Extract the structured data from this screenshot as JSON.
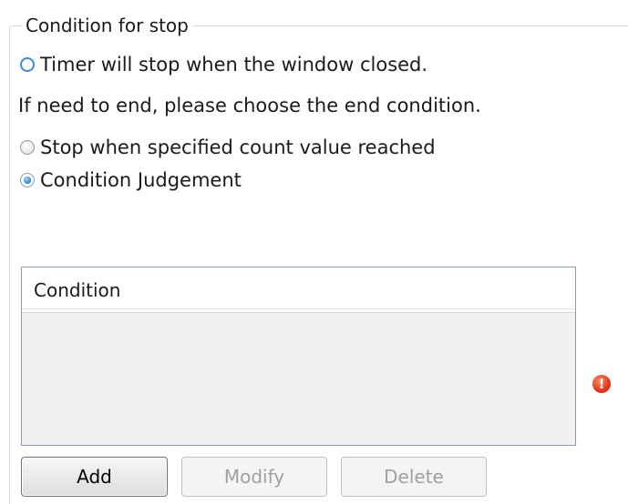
{
  "group": {
    "title": "Condition for stop"
  },
  "options": {
    "timer_close": "Timer will stop when the window closed.",
    "end_hint": "If need to end, please choose the end condition.",
    "count_reached": "Stop when specified count value reached",
    "condition_judgement": "Condition Judgement",
    "selected": "Condition Judgement"
  },
  "list": {
    "columns": [
      "Condition"
    ],
    "rows": []
  },
  "buttons": {
    "add": "Add",
    "modify": "Modify",
    "delete": "Delete"
  },
  "error_icon": {
    "name": "error-icon",
    "glyph": "!",
    "color": "#e0361a"
  }
}
